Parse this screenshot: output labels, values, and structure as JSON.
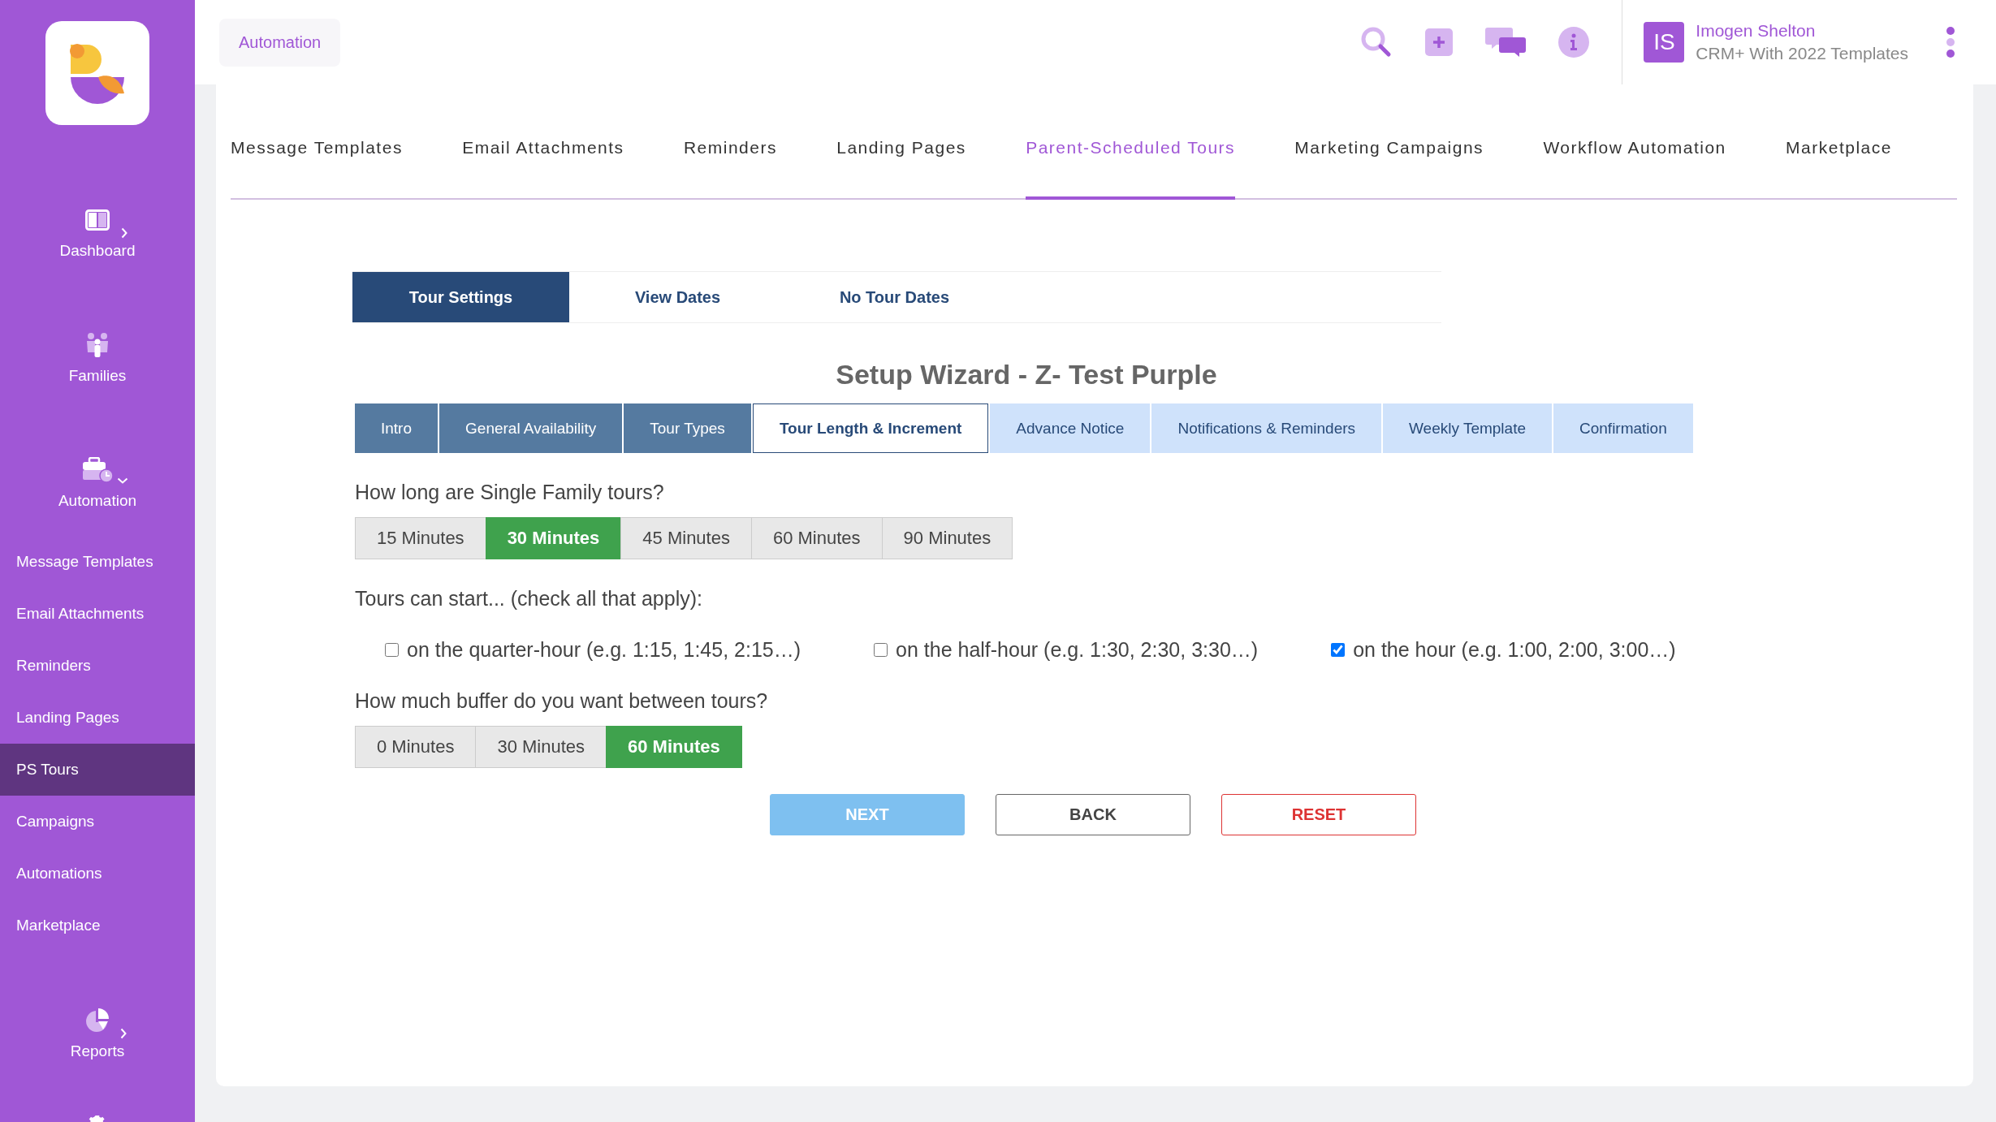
{
  "sidebar": {
    "main_items": [
      {
        "label": "Dashboard",
        "kind": "dashboard",
        "expanded": false
      },
      {
        "label": "Families",
        "kind": "families"
      },
      {
        "label": "Automation",
        "kind": "automation",
        "expanded": true
      }
    ],
    "sub_items": [
      {
        "label": "Message Templates",
        "selected": false
      },
      {
        "label": "Email Attachments",
        "selected": false
      },
      {
        "label": "Reminders",
        "selected": false
      },
      {
        "label": "Landing Pages",
        "selected": false
      },
      {
        "label": "PS Tours",
        "selected": true
      },
      {
        "label": "Campaigns",
        "selected": false
      },
      {
        "label": "Automations",
        "selected": false
      },
      {
        "label": "Marketplace",
        "selected": false
      }
    ],
    "bottom_items": [
      {
        "label": "Reports",
        "kind": "reports",
        "expanded": false
      }
    ]
  },
  "header": {
    "breadcrumb": "Automation",
    "user": {
      "initials": "IS",
      "name": "Imogen Shelton",
      "plan": "CRM+ With 2022 Templates"
    }
  },
  "nav_tabs": [
    {
      "label": "Message Templates",
      "selected": false
    },
    {
      "label": "Email Attachments",
      "selected": false
    },
    {
      "label": "Reminders",
      "selected": false
    },
    {
      "label": "Landing Pages",
      "selected": false
    },
    {
      "label": "Parent-Scheduled Tours",
      "selected": true
    },
    {
      "label": "Marketing Campaigns",
      "selected": false
    },
    {
      "label": "Workflow Automation",
      "selected": false
    },
    {
      "label": "Marketplace",
      "selected": false
    }
  ],
  "sub_tabs": [
    {
      "label": "Tour Settings",
      "selected": true
    },
    {
      "label": "View Dates",
      "selected": false
    },
    {
      "label": "No Tour Dates",
      "selected": false
    }
  ],
  "wizard": {
    "title": "Setup Wizard - Z- Test Purple",
    "steps": [
      {
        "label": "Intro",
        "completed": true,
        "selected": false
      },
      {
        "label": "General Availability",
        "completed": true,
        "selected": false
      },
      {
        "label": "Tour Types",
        "completed": true,
        "selected": false
      },
      {
        "label": "Tour Length & Increment",
        "completed": false,
        "selected": true
      },
      {
        "label": "Advance Notice",
        "completed": false,
        "selected": false
      },
      {
        "label": "Notifications & Reminders",
        "completed": false,
        "selected": false
      },
      {
        "label": "Weekly Template",
        "completed": false,
        "selected": false
      },
      {
        "label": "Confirmation",
        "completed": false,
        "selected": false
      }
    ],
    "length_question": "How long are Single Family tours?",
    "length_options": [
      {
        "label": "15 Minutes",
        "selected": false
      },
      {
        "label": "30 Minutes",
        "selected": true
      },
      {
        "label": "45 Minutes",
        "selected": false
      },
      {
        "label": "60 Minutes",
        "selected": false
      },
      {
        "label": "90 Minutes",
        "selected": false
      }
    ],
    "start_question": "Tours can start... (check all that apply):",
    "start_options": [
      {
        "label": "on the quarter-hour (e.g. 1:15, 1:45, 2:15…)",
        "checked": false
      },
      {
        "label": "on the half-hour (e.g. 1:30, 2:30, 3:30…)",
        "checked": false
      },
      {
        "label": "on the hour (e.g. 1:00, 2:00, 3:00…)",
        "checked": true
      }
    ],
    "buffer_question": "How much buffer do you want between tours?",
    "buffer_options": [
      {
        "label": "0 Minutes",
        "selected": false
      },
      {
        "label": "30 Minutes",
        "selected": false
      },
      {
        "label": "60 Minutes",
        "selected": true
      }
    ],
    "buttons": [
      {
        "label": "NEXT",
        "kind": "primary"
      },
      {
        "label": "BACK",
        "kind": "secondary"
      },
      {
        "label": "RESET",
        "kind": "danger"
      }
    ]
  }
}
